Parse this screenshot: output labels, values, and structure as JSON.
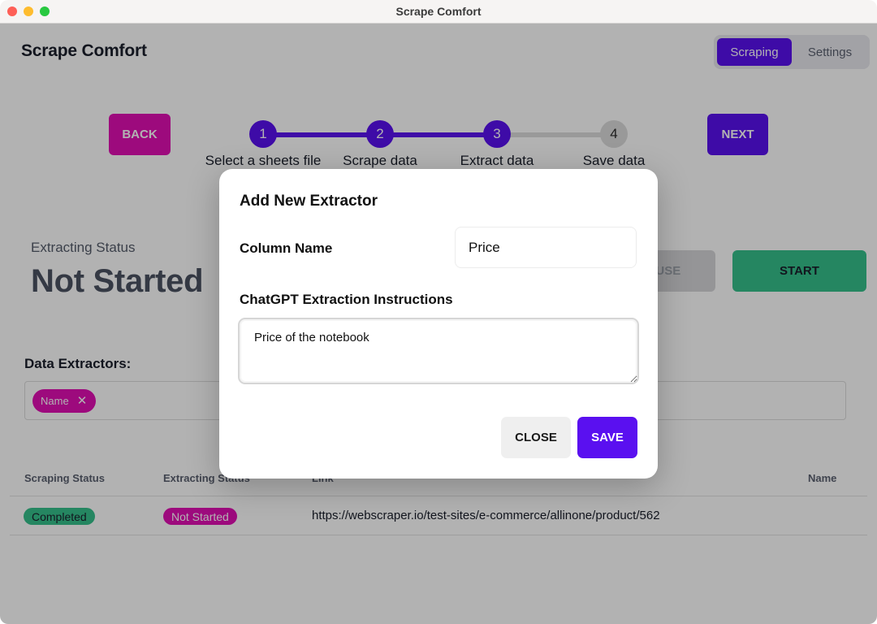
{
  "window": {
    "title": "Scrape Comfort"
  },
  "header": {
    "app_title": "Scrape Comfort",
    "tabs": [
      {
        "label": "Scraping",
        "active": true
      },
      {
        "label": "Settings",
        "active": false
      }
    ]
  },
  "wizard": {
    "back_label": "BACK",
    "next_label": "NEXT",
    "current_step": 3,
    "steps": [
      {
        "number": "1",
        "label": "Select a sheets file",
        "completed": true
      },
      {
        "number": "2",
        "label": "Scrape data",
        "completed": true
      },
      {
        "number": "3",
        "label": "Extract data",
        "completed": true
      },
      {
        "number": "4",
        "label": "Save data",
        "completed": false
      }
    ]
  },
  "extracting": {
    "status_label": "Extracting Status",
    "status_value": "Not Started",
    "pause_label": "PAUSE",
    "start_label": "START"
  },
  "extractors": {
    "label": "Data Extractors:",
    "chips": [
      {
        "label": "Name",
        "remove_icon": "close-icon"
      }
    ]
  },
  "table": {
    "columns": [
      "Scraping Status",
      "Extracting Status",
      "Link",
      "Name"
    ],
    "rows": [
      {
        "scraping_status": "Completed",
        "extracting_status": "Not Started",
        "link": "https://webscraper.io/test-sites/e-commerce/allinone/product/562",
        "name": ""
      }
    ]
  },
  "modal": {
    "title": "Add New Extractor",
    "column_name_label": "Column Name",
    "column_name_value": "Price",
    "instructions_label": "ChatGPT Extraction Instructions",
    "instructions_value": "Price of the notebook",
    "close_label": "CLOSE",
    "save_label": "SAVE"
  },
  "colors": {
    "primary": "#5a10f0",
    "accent_pink": "#e10fb3",
    "success_green": "#35c18b"
  }
}
